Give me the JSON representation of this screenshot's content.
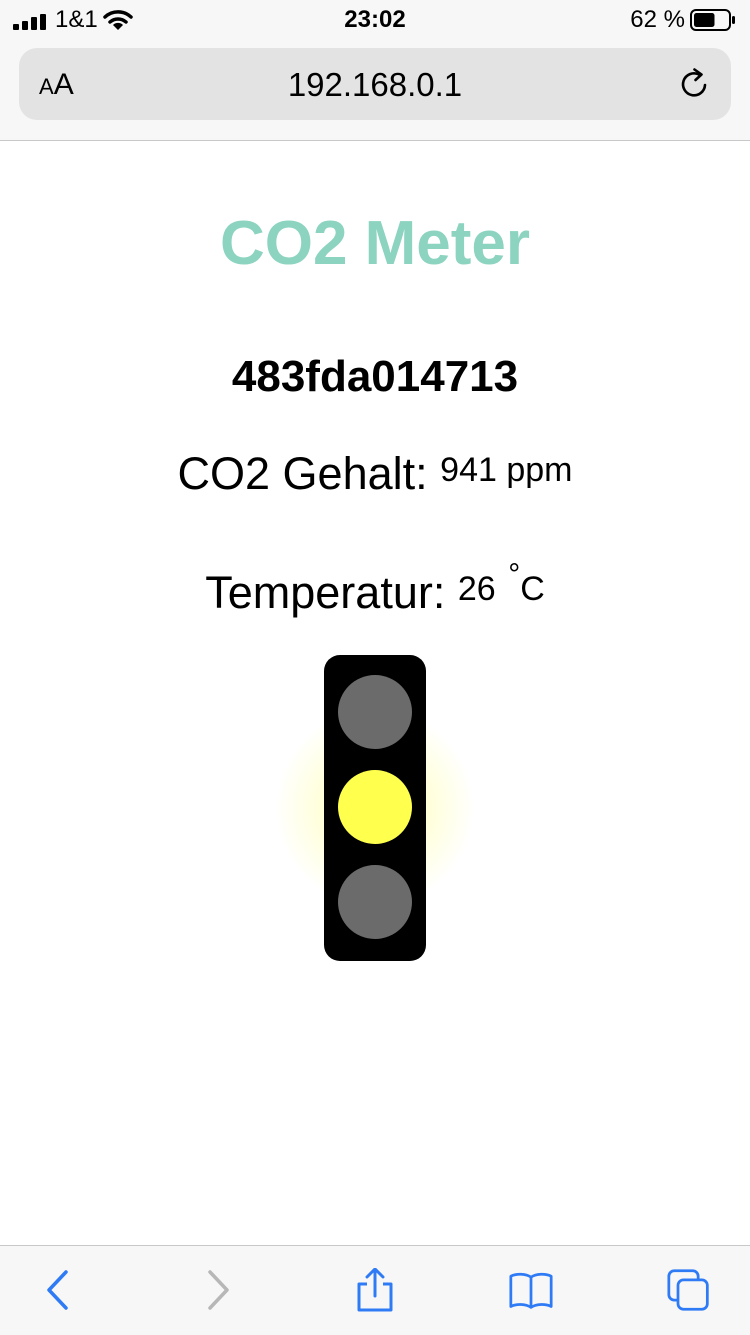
{
  "status_bar": {
    "carrier": "1&1",
    "time": "23:02",
    "battery_percent": "62 %",
    "battery_level": 0.62
  },
  "address_bar": {
    "text_size_label_small": "A",
    "text_size_label_large": "A",
    "url": "192.168.0.1"
  },
  "page": {
    "title": "CO2 Meter",
    "device_id": "483fda014713",
    "co2_label": "CO2 Gehalt:",
    "co2_value": "941 ppm",
    "temperature_label": "Temperatur:",
    "temperature_value": "26",
    "temperature_unit_degree": "°",
    "temperature_unit": "C",
    "traffic_light": {
      "active": "yellow",
      "colors": {
        "active_yellow": "#ffff4d",
        "inactive": "#6b6b6b",
        "housing": "#000000"
      }
    },
    "title_color": "#8cd3c0"
  },
  "toolbar": {
    "icons": [
      "back-icon",
      "forward-icon",
      "share-icon",
      "bookmarks-icon",
      "tabs-icon"
    ],
    "accent_color": "#2f7bf5"
  }
}
